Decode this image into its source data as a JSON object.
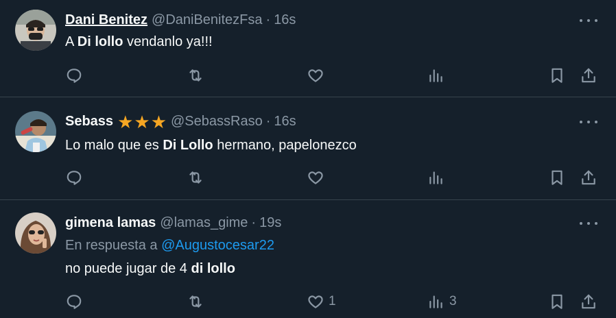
{
  "tweets": [
    {
      "name": "Dani Benitez",
      "handle": "@DaniBenitezFsa",
      "dot": "·",
      "time": "16s",
      "text_pre": "A ",
      "text_bold": "Di lollo",
      "text_post": " vendanlo ya!!!",
      "likes": "",
      "views": ""
    },
    {
      "name": "Sebass",
      "stars": [
        "★",
        "★",
        "★"
      ],
      "handle": "@SebassRaso",
      "dot": "·",
      "time": "16s",
      "text_pre": "Lo malo que es ",
      "text_bold": "Di Lollo",
      "text_post": " hermano, papelonezco",
      "likes": "",
      "views": ""
    },
    {
      "name": "gimena lamas",
      "handle": "@lamas_gime",
      "dot": "·",
      "time": "19s",
      "reply_label": "En respuesta a ",
      "reply_mention": "@Augustocesar22",
      "text_pre": "no puede jugar de 4 ",
      "text_bold": "di lollo",
      "text_post": "",
      "likes": "1",
      "views": "3"
    }
  ],
  "icons": {
    "reply": "reply-icon",
    "retweet": "retweet-icon",
    "like": "heart-icon",
    "views": "views-icon",
    "bookmark": "bookmark-icon",
    "share": "share-icon",
    "more": "more-icon"
  },
  "colors": {
    "background": "#15202b",
    "divider": "#38444d",
    "muted": "#8b98a5",
    "link": "#1d9bf0",
    "star": "#f5a623"
  }
}
